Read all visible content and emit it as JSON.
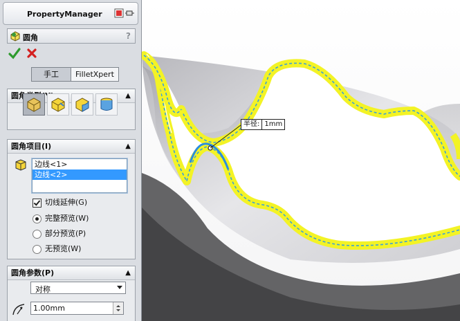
{
  "panel": {
    "title": "PropertyManager",
    "feature_name": "圆角",
    "help": "?",
    "tabs": {
      "manual": "手工",
      "expert": "FilletXpert"
    },
    "fillet_type": {
      "header": "圆角类型(Y)"
    },
    "fillet_items": {
      "header": "圆角项目(I)",
      "edges": [
        "边线<1>",
        "边线<2>"
      ],
      "tangent_propagation": "切线延伸(G)",
      "preview_full": "完整预览(W)",
      "preview_partial": "部分预览(P)",
      "preview_none": "无预览(W)"
    },
    "fillet_params": {
      "header": "圆角参数(P)",
      "method": "对称",
      "radius": "1.00mm"
    }
  },
  "viewport": {
    "radius_label": "半径:",
    "radius_value": "1mm",
    "highlight_color": "#f3f325",
    "edge_color": "#3aa0d8"
  }
}
